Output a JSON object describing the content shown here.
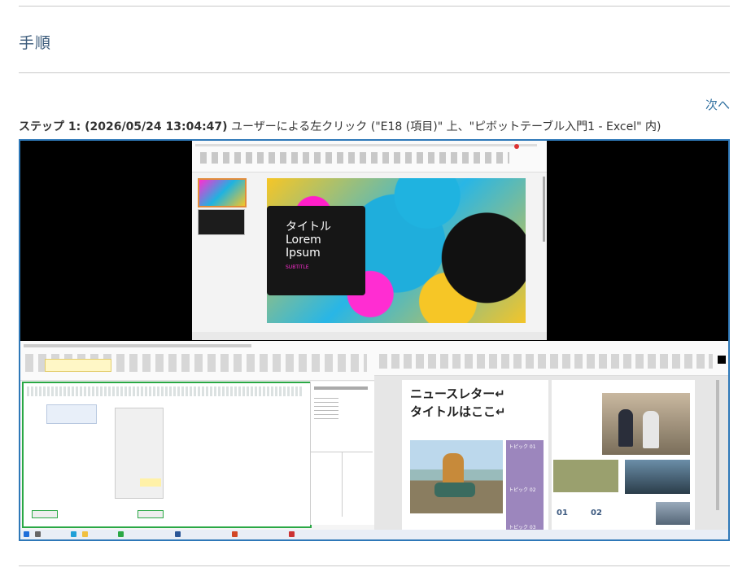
{
  "section_title": "手順",
  "nav": {
    "next_label": "次へ"
  },
  "step": {
    "prefix": "ステップ 1: (2026/05/24 13:04:47)",
    "description": " ユーザーによる左クリック (\"E18 (項目)\" 上、\"ピボットテーブル入門1 - Excel\" 内)"
  },
  "screenshot": {
    "slide": {
      "title_lines": [
        "タイトル",
        "Lorem",
        "Ipsum"
      ],
      "subtitle": "SUBTITLE"
    },
    "newsletter": {
      "title_line1": "ニュースレター↵",
      "title_line2": "タイトルはここ↵",
      "topic_labels": [
        "トピック 01",
        "トピック 02",
        "トピック 03"
      ],
      "numbers": [
        "01",
        "02"
      ]
    },
    "colors": {
      "frame_border": "#2e78b8",
      "accent_magenta": "#ff2dd2",
      "accent_cyan": "#1fb3e0",
      "accent_yellow": "#f6c626",
      "newsletter_purple": "#9c86bd",
      "newsletter_olive": "#9aa06e",
      "excel_green": "#2aa845"
    }
  }
}
